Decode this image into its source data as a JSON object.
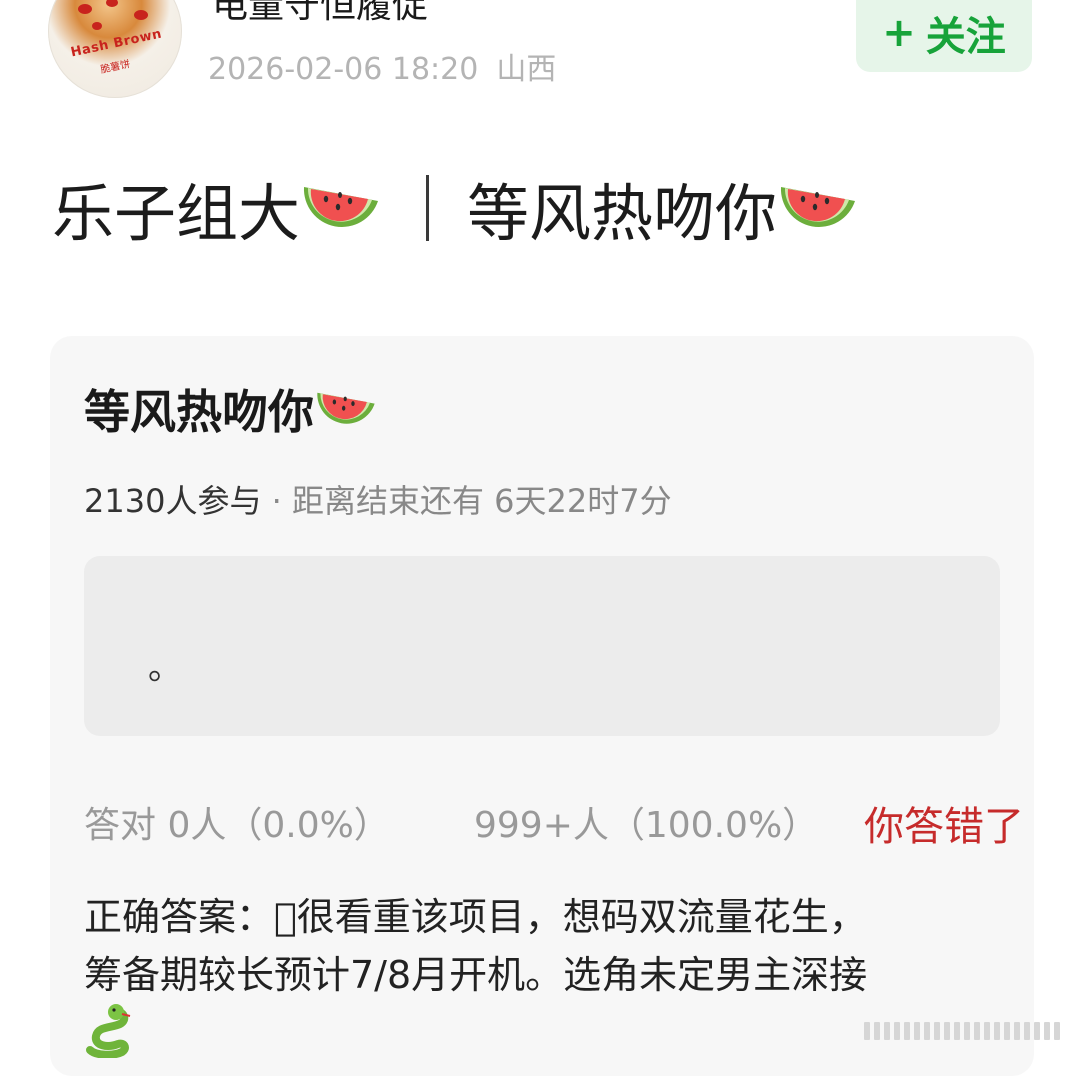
{
  "header": {
    "username": "电量守恒履促",
    "timestamp": "2026-02-06 18:20",
    "location": "山西",
    "avatar_text": "Hash Brown",
    "avatar_subtext": "脆薯饼",
    "follow_icon": "+",
    "follow_label": "关注"
  },
  "post": {
    "headline_left": "乐子组大",
    "headline_right": "等风热吻你",
    "headline_emoji": "watermelon"
  },
  "quiz": {
    "title": "等风热吻你",
    "participants": "2130人参与",
    "dot": " · ",
    "countdown": "距离结束还有 6天22时7分",
    "option_text": "。",
    "correct_stat": "答对  0人（0.0%）",
    "other_stat": "999+人（100.0%）",
    "result_label": "你答错了",
    "answer_line1": "正确答案：\u0000很看重该项目，想码双流量花生，",
    "answer_line2": "筹备期较长预计7/8月开机。选角未定男主深接",
    "answer_emoji": "snake"
  },
  "colors": {
    "follow_bg": "#e6f5e9",
    "follow_text": "#17a33a",
    "wrong_text": "#c62b2b",
    "meta_text": "#b4b4b4"
  }
}
